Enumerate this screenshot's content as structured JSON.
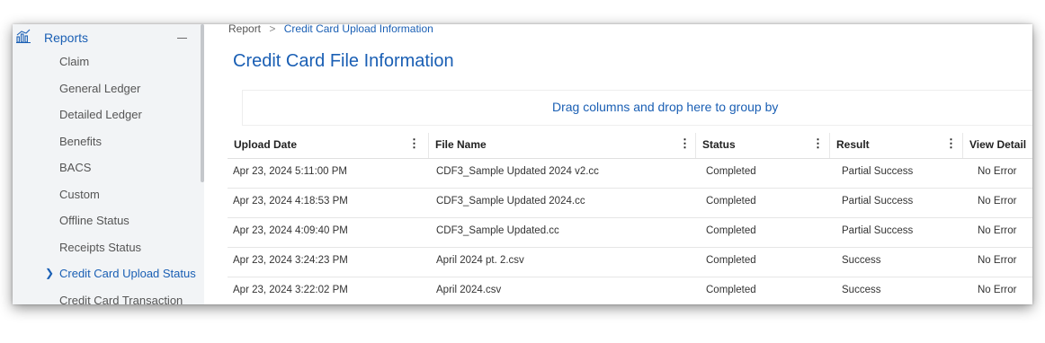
{
  "sidebar": {
    "section_label": "Reports",
    "items": [
      {
        "label": "Claim"
      },
      {
        "label": "General Ledger"
      },
      {
        "label": "Detailed Ledger"
      },
      {
        "label": "Benefits"
      },
      {
        "label": "BACS"
      },
      {
        "label": "Custom"
      },
      {
        "label": "Offline Status"
      },
      {
        "label": "Receipts Status"
      },
      {
        "label": "Credit Card Upload Status",
        "active": true
      },
      {
        "label": "Credit Card Transaction"
      }
    ]
  },
  "breadcrumb": {
    "root": "Report",
    "separator": ">",
    "current": "Credit Card Upload Information"
  },
  "page": {
    "title": "Credit Card File Information"
  },
  "grid": {
    "group_hint": "Drag columns and drop here to group by",
    "columns": [
      {
        "label": "Upload Date"
      },
      {
        "label": "File Name"
      },
      {
        "label": "Status"
      },
      {
        "label": "Result"
      },
      {
        "label": "View Detail"
      }
    ],
    "rows": [
      {
        "upload_date": "Apr 23, 2024 5:11:00 PM",
        "file_name": "CDF3_Sample Updated 2024 v2.cc",
        "status": "Completed",
        "result": "Partial Success",
        "view_detail": "No Error"
      },
      {
        "upload_date": "Apr 23, 2024 4:18:53 PM",
        "file_name": "CDF3_Sample Updated 2024.cc",
        "status": "Completed",
        "result": "Partial Success",
        "view_detail": "No Error"
      },
      {
        "upload_date": "Apr 23, 2024 4:09:40 PM",
        "file_name": "CDF3_Sample Updated.cc",
        "status": "Completed",
        "result": "Partial Success",
        "view_detail": "No Error"
      },
      {
        "upload_date": "Apr 23, 2024 3:24:23 PM",
        "file_name": "April 2024 pt. 2.csv",
        "status": "Completed",
        "result": "Success",
        "view_detail": "No Error"
      },
      {
        "upload_date": "Apr 23, 2024 3:22:02 PM",
        "file_name": "April 2024.csv",
        "status": "Completed",
        "result": "Success",
        "view_detail": "No Error"
      }
    ]
  },
  "icons": {
    "reports": "bar-chart-icon",
    "collapse": "minus-icon",
    "active_marker": "chevron-right-icon",
    "column_menu": "kebab-menu-icon"
  },
  "colors": {
    "accent": "#1a5fb4",
    "sidebar_bg": "#f2f4f6"
  }
}
